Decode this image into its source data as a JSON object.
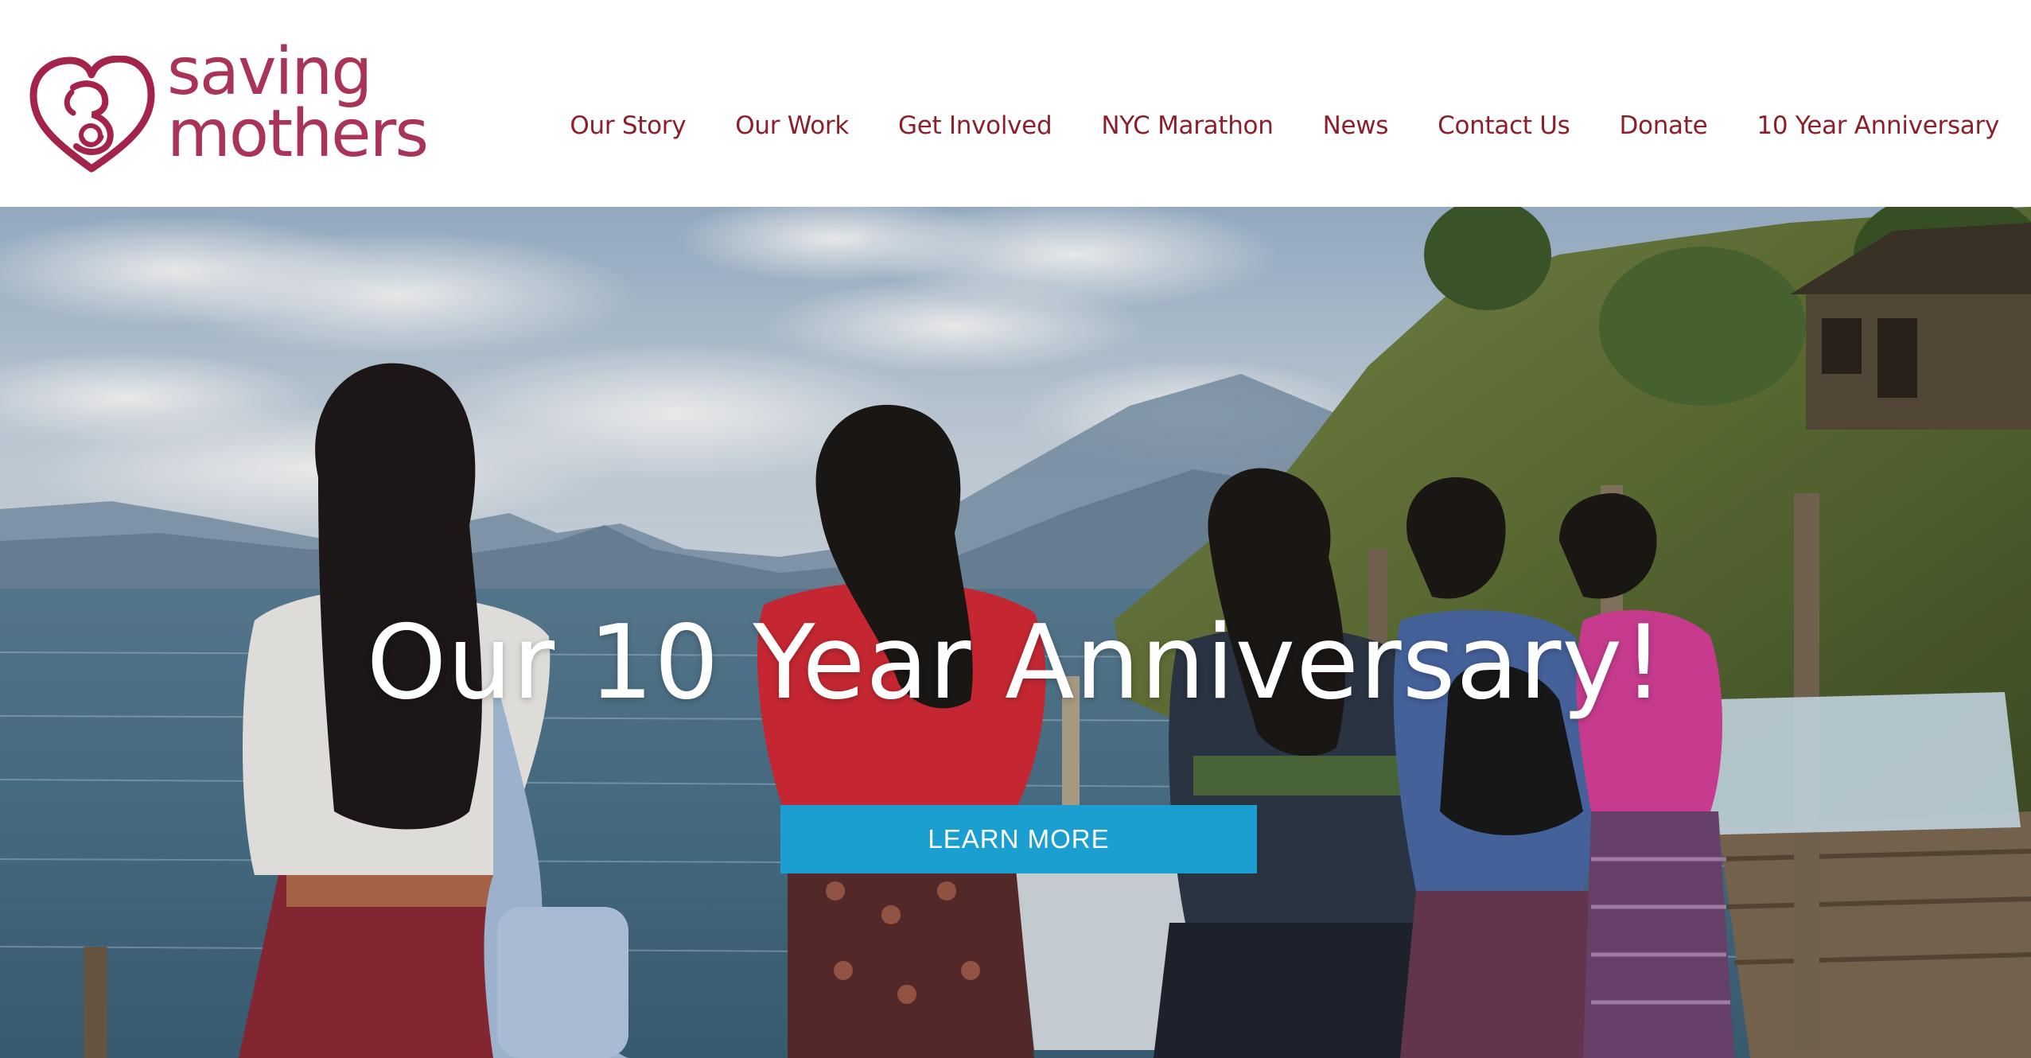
{
  "brand": {
    "name_line1": "saving",
    "name_line2": "mothers",
    "logo_icon": "heart-mother-child-icon",
    "brand_color": "#a3234a"
  },
  "nav": {
    "items": [
      {
        "label": "Our Story"
      },
      {
        "label": "Our Work"
      },
      {
        "label": "Get Involved"
      },
      {
        "label": "NYC Marathon"
      },
      {
        "label": "News"
      },
      {
        "label": "Contact Us"
      },
      {
        "label": "Donate"
      },
      {
        "label": "10 Year Anniversary"
      }
    ],
    "text_color": "#8b1f2c"
  },
  "hero": {
    "title": "Our 10 Year Anniversary!",
    "button_label": "LEARN MORE",
    "button_color": "#1a9fd0",
    "image_subject": "women-by-lake-photo"
  }
}
